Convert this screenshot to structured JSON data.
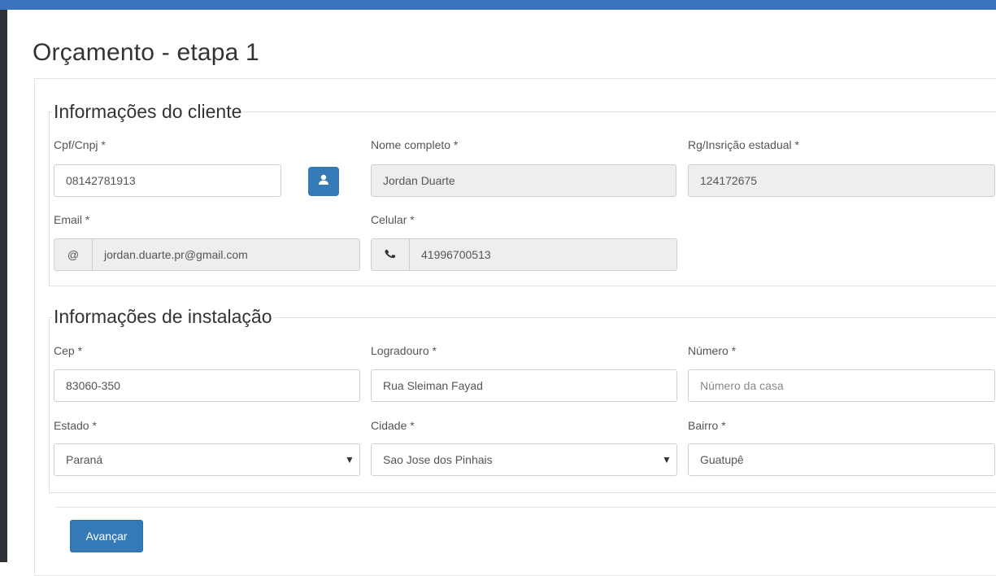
{
  "page": {
    "title": "Orçamento - etapa 1"
  },
  "client": {
    "legend": "Informações do cliente",
    "cpf": {
      "label": "Cpf/Cnpj *",
      "value": "08142781913"
    },
    "nome": {
      "label": "Nome completo *",
      "value": "Jordan Duarte"
    },
    "rg": {
      "label": "Rg/Insrição estadual *",
      "value": "124172675"
    },
    "email": {
      "label": "Email *",
      "addon": "@",
      "value": "jordan.duarte.pr@gmail.com"
    },
    "celular": {
      "label": "Celular *",
      "value": "41996700513"
    },
    "lookup_icon": "user-icon",
    "phone_icon": "phone-icon"
  },
  "install": {
    "legend": "Informações de instalação",
    "cep": {
      "label": "Cep *",
      "value": "83060-350"
    },
    "logradouro": {
      "label": "Logradouro *",
      "value": "Rua Sleiman Fayad"
    },
    "numero": {
      "label": "Número *",
      "placeholder": "Número da casa"
    },
    "estado": {
      "label": "Estado *",
      "value": "Paraná"
    },
    "cidade": {
      "label": "Cidade *",
      "value": "Sao Jose dos Pinhais"
    },
    "bairro": {
      "label": "Bairro *",
      "value": "Guatupê"
    }
  },
  "actions": {
    "next_label": "Avançar"
  },
  "colors": {
    "accent": "#337ab7",
    "topbar": "#3a72bf",
    "readonly_bg": "#eeeeee"
  }
}
